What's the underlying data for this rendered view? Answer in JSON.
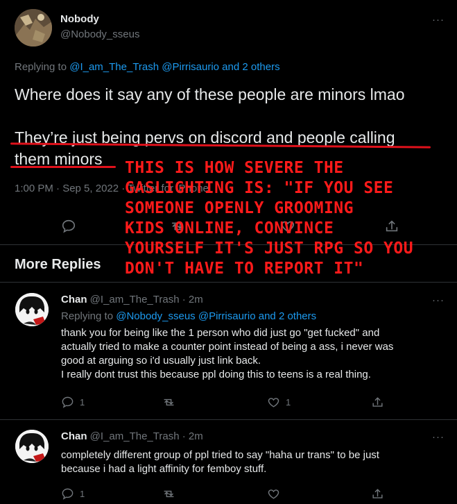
{
  "tweet": {
    "name": "Nobody",
    "handle": "@Nobody_sseus",
    "replying_prefix": "Replying to",
    "replying_to": "@I_am_The_Trash @Pirrisaurio and 2 others",
    "line1": "Where does it say any of these people are minors lmao",
    "line2": "They’re just being pervs on discord and people calling",
    "line3": "them minors",
    "meta": "1:00 PM · Sep 5, 2022 · Twitter for iPhone"
  },
  "annotation": {
    "lines": [
      "THIS IS HOW SEVERE THE",
      "GASLIGHTING IS: \"IF YOU SEE",
      "SOMEONE OPENLY GROOMING",
      "KIDS ONLINE, CONVINCE",
      "YOURSELF IT'S JUST RPG SO YOU",
      "DON'T HAVE TO REPORT IT\""
    ]
  },
  "more_replies_title": "More Replies",
  "more_options": "···",
  "replies": [
    {
      "name": "Chan",
      "handle": "@I_am_The_Trash",
      "time": "· 2m",
      "replying_prefix": "Replying to",
      "replying_to": "@Nobody_sseus @Pirrisaurio and 2 others",
      "lines": [
        "thank you for being like the 1 person who did just go \"get fucked\" and",
        "actually tried to make a counter point instead of  being a ass, i never was",
        "good at arguing so i'd usually just link back.",
        "I really dont trust this because ppl doing this to teens is a real thing."
      ],
      "reply_count": "1",
      "like_count": "1"
    },
    {
      "name": "Chan",
      "handle": "@I_am_The_Trash",
      "time": "· 2m",
      "lines": [
        "completely different group of ppl tried to say \"haha ur trans\" to be just",
        "because i had a light affinity for femboy stuff."
      ],
      "reply_count": "1"
    }
  ],
  "icons": {
    "reply": "reply-icon",
    "retweet": "retweet-icon",
    "like": "like-icon",
    "share": "share-icon"
  }
}
